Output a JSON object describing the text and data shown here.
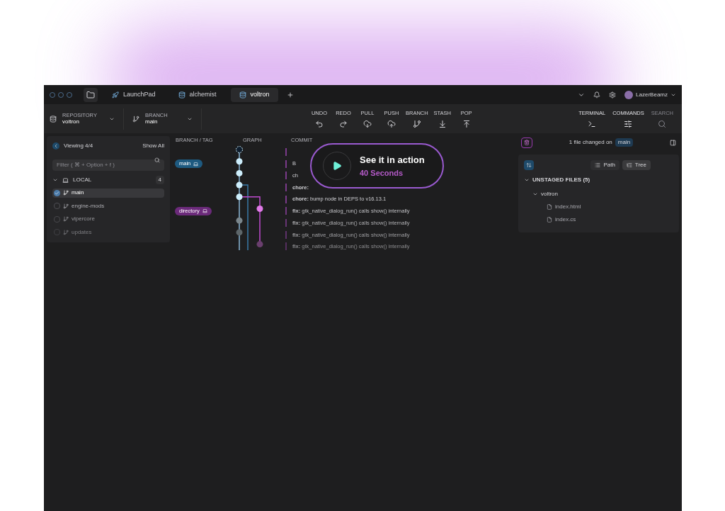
{
  "tabs": [
    {
      "label": "LaunchPad",
      "selected": false
    },
    {
      "label": "alchemist",
      "selected": false
    },
    {
      "label": "voltron",
      "selected": true
    }
  ],
  "user": {
    "name": "LazerBeamz"
  },
  "toolbar": {
    "repository": {
      "label": "REPOSITORY",
      "value": "voltron"
    },
    "branch": {
      "label": "BRANCH",
      "value": "main"
    },
    "actions": [
      {
        "label": "UNDO"
      },
      {
        "label": "REDO"
      },
      {
        "label": "PULL"
      },
      {
        "label": "PUSH"
      },
      {
        "label": "BRANCH"
      },
      {
        "label": "STASH"
      },
      {
        "label": "POP"
      }
    ],
    "right_actions": [
      {
        "label": "TERMINAL",
        "disabled": false
      },
      {
        "label": "COMMANDS",
        "disabled": false
      },
      {
        "label": "SEARCH",
        "disabled": true
      }
    ]
  },
  "sidebar": {
    "viewing": "Viewing 4/4",
    "show_all": "Show All",
    "filter": {
      "placeholder": "Filter ( ⌘ + Option + f )"
    },
    "section": {
      "label": "LOCAL",
      "count": "4",
      "expanded": true
    },
    "branches": [
      {
        "name": "main",
        "checked": true,
        "selected": true
      },
      {
        "name": "engine-mods",
        "checked": false,
        "selected": false
      },
      {
        "name": "vipercore",
        "checked": false,
        "selected": false
      },
      {
        "name": "updates",
        "checked": false,
        "selected": false
      }
    ]
  },
  "graph": {
    "columns": [
      "BRANCH / TAG",
      "GRAPH",
      "COMMIT"
    ],
    "commits": [
      {
        "kind": "working-copy",
        "color": "#0f1e2e"
      },
      {
        "kind": "commit",
        "message": "B",
        "color": "#cdeefc",
        "tag": {
          "label": "main",
          "color": "#1e5a80"
        }
      },
      {
        "kind": "commit",
        "message": "ch",
        "color": "#cdeefc"
      },
      {
        "kind": "commit",
        "message": "**chore:**",
        "color": "#cdeefc"
      },
      {
        "kind": "commit",
        "message": "**chore:** bump node in DEPS to v16.13.1",
        "color": "#cdeefc"
      },
      {
        "kind": "commit",
        "message": "**fix:** gtk_native_dialog_run() calls show() internally",
        "color": "#e07ae8",
        "tag": {
          "label": "directory",
          "color": "#6b2a7a"
        }
      },
      {
        "kind": "commit",
        "message": "**fix:** gtk_native_dialog_run() calls show() internally",
        "color": "#7a868c"
      },
      {
        "kind": "commit",
        "message": "**fix:** gtk_native_dialog_run() calls show() internally",
        "color": "#5d666a"
      },
      {
        "kind": "commit",
        "message": "**fix:** gtk_native_dialog_run() calls show() internally",
        "color": "#6a3f6e"
      }
    ]
  },
  "video": {
    "title": "See it in action",
    "duration": "40 Seconds"
  },
  "changes": {
    "summary": "1 file changed on",
    "branch": "main",
    "views": [
      {
        "label": "Path",
        "selected": false
      },
      {
        "label": "Tree",
        "selected": true
      }
    ],
    "section": {
      "label": "UNSTAGED FILES (5)",
      "expanded": true
    },
    "tree": [
      {
        "name": "voltron",
        "expanded": true,
        "children": [
          {
            "name": "index.html"
          },
          {
            "name": "index.cs"
          }
        ]
      }
    ]
  }
}
